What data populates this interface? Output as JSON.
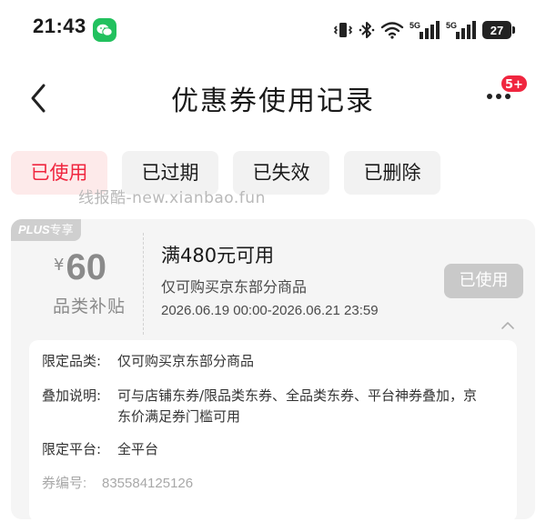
{
  "status_bar": {
    "time": "21:43",
    "battery": "27",
    "signal_1_label": "5G",
    "signal_2_label": "5G",
    "icons": [
      "wechat-icon",
      "vibrate-icon",
      "bluetooth-icon",
      "wifi-icon",
      "signal-icon",
      "signal-icon",
      "battery-icon"
    ]
  },
  "nav": {
    "title": "优惠券使用记录",
    "badge": "5+"
  },
  "tabs": [
    {
      "label": "已使用",
      "active": true
    },
    {
      "label": "已过期",
      "active": false
    },
    {
      "label": "已失效",
      "active": false
    },
    {
      "label": "已删除",
      "active": false
    }
  ],
  "watermark": "线报酷-new.xianbao.fun",
  "coupon": {
    "tag": "PLUS专享",
    "tag_brand": "PLUS",
    "tag_suffix": "专享",
    "currency": "¥",
    "amount": "60",
    "category_label": "品类补贴",
    "condition": "满480元可用",
    "scope": "仅可购买京东部分商品",
    "validity": "2026.06.19 00:00-2026.06.21 23:59",
    "status_button": "已使用",
    "details": [
      {
        "label": "限定品类:",
        "value": "仅可购买京东部分商品"
      },
      {
        "label": "叠加说明:",
        "value": "可与店铺东券/限品类东券、全品类东券、平台神券叠加，京东价满足券门槛可用"
      },
      {
        "label": "限定平台:",
        "value": "全平台"
      },
      {
        "label": "券编号:",
        "value": "835584125126"
      }
    ]
  },
  "colors": {
    "accent": "#f0263f",
    "active_tab_bg": "#fdeaea",
    "tab_bg": "#f2f2f2",
    "card_bg": "#f5f5f5",
    "muted": "#8a8a8a",
    "wechat": "#22c15e"
  }
}
